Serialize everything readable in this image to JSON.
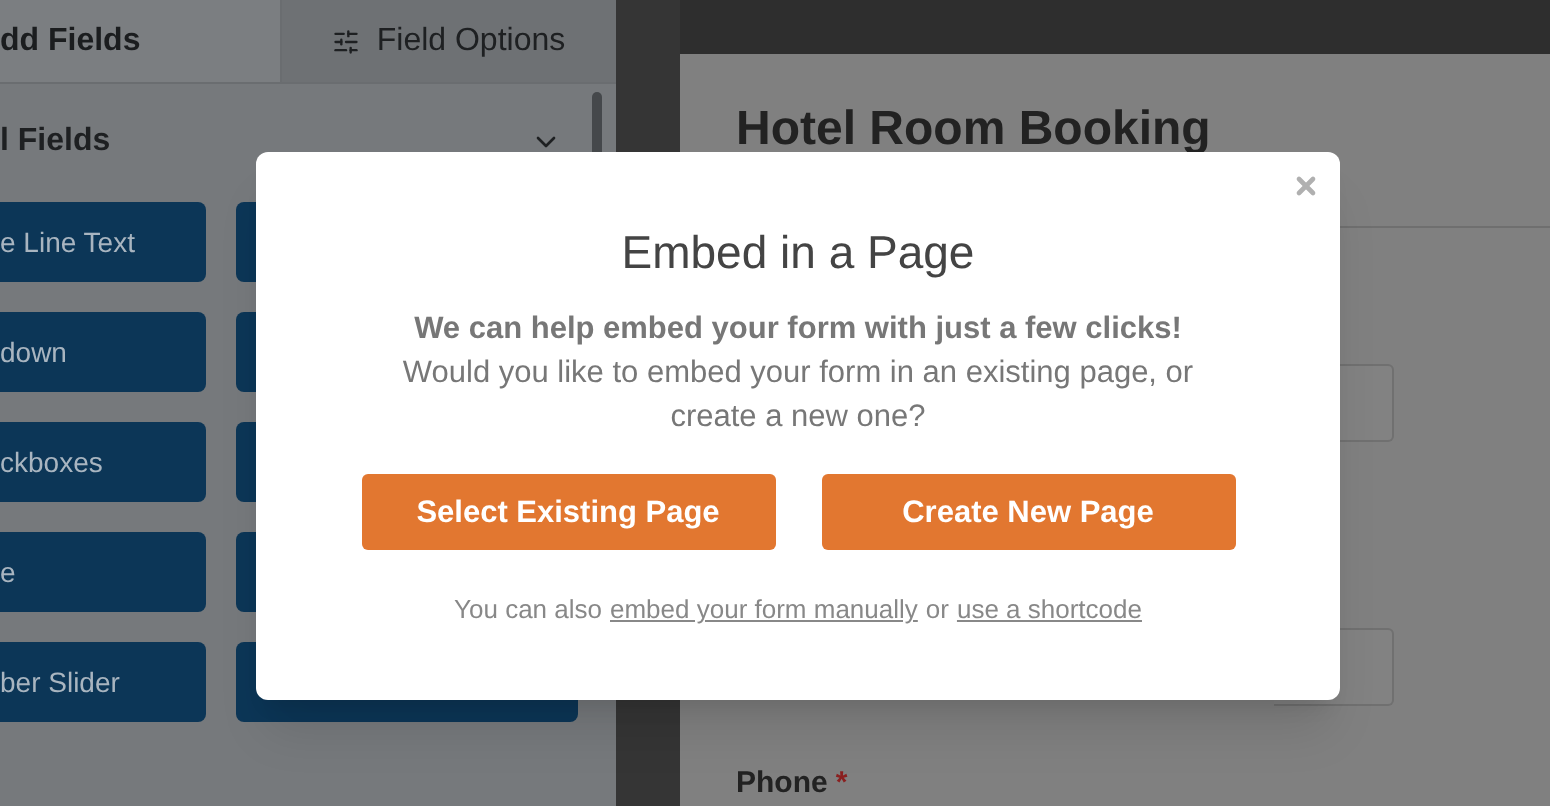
{
  "sidebar": {
    "tabs": [
      {
        "label": "dd Fields",
        "selected": true
      },
      {
        "label": "Field Options",
        "selected": false
      }
    ],
    "section": {
      "title": "l Fields",
      "expanded": true
    },
    "field_rows": [
      {
        "label": "e Line Text"
      },
      {
        "label": "down"
      },
      {
        "label": "ckboxes"
      },
      {
        "label": "e"
      },
      {
        "label": "ber Slider"
      }
    ]
  },
  "form": {
    "title": "Hotel Room Booking",
    "fields": [
      {
        "kind": "input"
      },
      {
        "kind": "input"
      },
      {
        "kind": "label",
        "label": "Phone",
        "required": true,
        "required_mark": "*"
      }
    ]
  },
  "modal": {
    "title": "Embed in a Page",
    "lead": "We can help embed your form with just a few clicks!",
    "body": "Would you like to embed your form in an existing page, or create a new one?",
    "buttons": [
      "Select Existing Page",
      "Create New Page"
    ],
    "footer": {
      "prefix": "You can also",
      "link_1": "embed your form manually",
      "middle": "or",
      "link_2": "use a shortcode"
    }
  }
}
